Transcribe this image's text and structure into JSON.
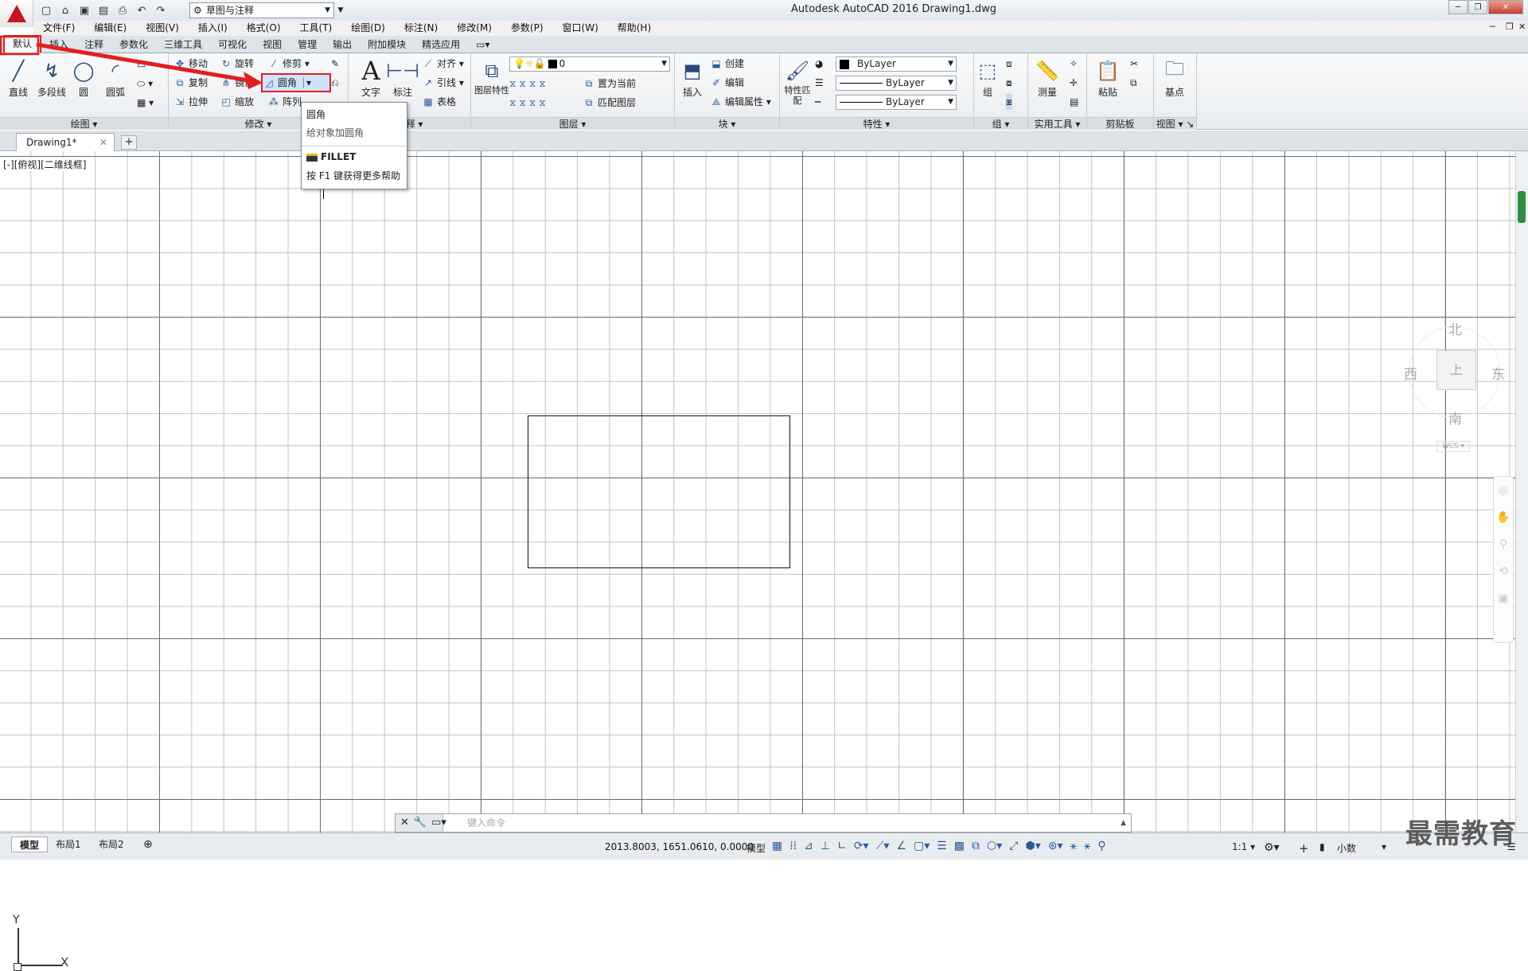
{
  "titlebar": {
    "workspace": "草图与注释",
    "title": "Autodesk AutoCAD 2016    Drawing1.dwg"
  },
  "menu": [
    "文件(F)",
    "编辑(E)",
    "视图(V)",
    "插入(I)",
    "格式(O)",
    "工具(T)",
    "绘图(D)",
    "标注(N)",
    "修改(M)",
    "参数(P)",
    "窗口(W)",
    "帮助(H)"
  ],
  "ribbon_tabs": [
    "默认",
    "插入",
    "注释",
    "参数化",
    "三维工具",
    "可视化",
    "视图",
    "管理",
    "输出",
    "附加模块",
    "精选应用"
  ],
  "ribbon": {
    "draw": {
      "title": "绘图",
      "line": "直线",
      "polyline": "多段线",
      "circle": "圆",
      "arc": "圆弧"
    },
    "modify": {
      "title": "修改",
      "move": "移动",
      "rotate": "旋转",
      "trim": "修剪",
      "copy": "复制",
      "mirror": "镜像",
      "fillet": "圆角",
      "stretch": "拉伸",
      "scale": "缩放",
      "array": "阵列"
    },
    "annotation": {
      "title": "注释",
      "text": "文字",
      "dim": "标注",
      "align": "对齐",
      "leader": "引线",
      "table": "表格"
    },
    "layers": {
      "title": "图层",
      "props": "图层特性",
      "layer_name": "0",
      "set_current": "置为当前",
      "match_layer": "匹配图层"
    },
    "block": {
      "title": "块",
      "insert": "插入",
      "create": "创建",
      "edit": "编辑",
      "edit_attr": "编辑属性"
    },
    "properties": {
      "title": "特性",
      "match": "特性匹配",
      "color": "ByLayer",
      "linetype": "ByLayer",
      "lineweight": "ByLayer"
    },
    "group": {
      "title": "组",
      "group": "组"
    },
    "utilities": {
      "title": "实用工具",
      "measure": "测量"
    },
    "clipboard": {
      "title": "剪贴板",
      "paste": "粘贴"
    },
    "view": {
      "title": "视图",
      "base": "基点"
    }
  },
  "tooltip": {
    "title": "圆角",
    "desc": "给对象加圆角",
    "command": "FILLET",
    "help": "按 F1 键获得更多帮助"
  },
  "doc_tab": "Drawing1*",
  "view_label": "[-][俯视][二维线框]",
  "viewcube": {
    "north": "北",
    "south": "南",
    "east": "东",
    "west": "西",
    "top": "上",
    "wcs": "WCS"
  },
  "ucs": {
    "x": "X",
    "y": "Y"
  },
  "command": {
    "placeholder": "键入命令"
  },
  "layout_tabs": [
    "模型",
    "布局1",
    "布局2"
  ],
  "status": {
    "coords": "2013.8003, 1651.0610, 0.0000",
    "model": "模型",
    "scale": "1:1",
    "units": "小数"
  },
  "watermark": "最需教育"
}
